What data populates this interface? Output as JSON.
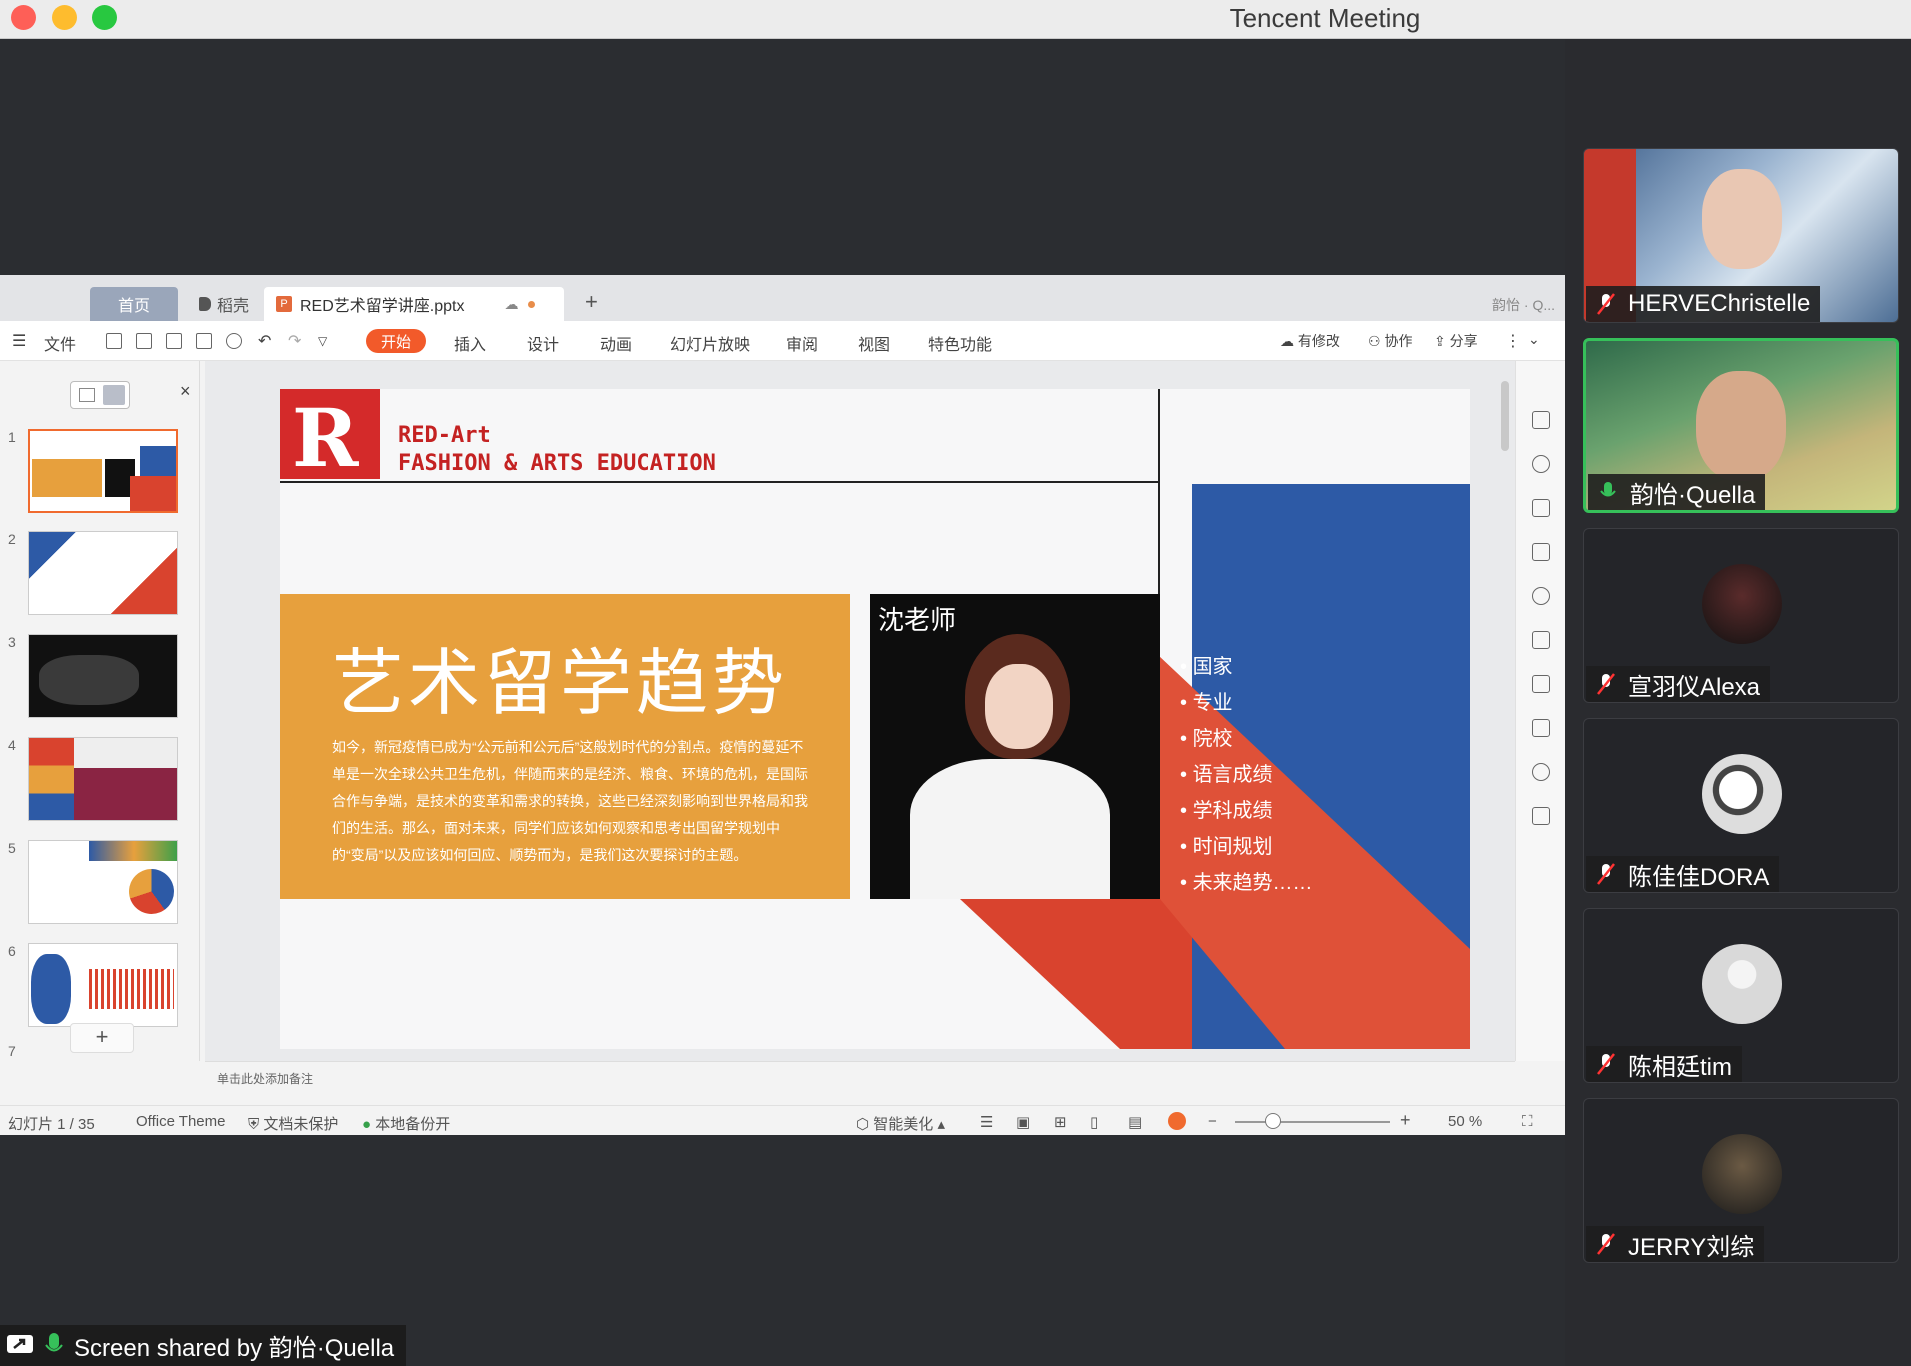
{
  "window": {
    "title": "Tencent Meeting"
  },
  "wps": {
    "tabs": {
      "home": "首页",
      "daoke": "稻壳",
      "file": "RED艺术留学讲座.pptx",
      "plus": "+",
      "user": "韵怡 · Q..."
    },
    "toolbar": {
      "file_menu": "文件",
      "start": "开始",
      "insert": "插入",
      "design": "设计",
      "animation": "动画",
      "slideshow": "幻灯片放映",
      "review": "审阅",
      "view": "视图",
      "special": "特色功能",
      "modified": "有修改",
      "collab": "协作",
      "share": "分享"
    },
    "thumbnails": [
      "1",
      "2",
      "3",
      "4",
      "5",
      "6",
      "7"
    ],
    "thumb_add": "+",
    "notes_placeholder": "单击此处添加备注",
    "slide": {
      "brand_line1": "RED-Art",
      "brand_line2": "FASHION & ARTS EDUCATION",
      "headline": "艺术留学趋势",
      "body": "如今，新冠疫情已成为“公元前和公元后”这般划时代的分割点。疫情的蔓延不单是一次全球公共卫生危机，伴随而来的是经济、粮食、环境的危机，是国际合作与争端，是技术的变革和需求的转换，这些已经深刻影响到世界格局和我们的生活。那么，面对未来，同学们应该如何观察和思考出国留学规划中的“变局”以及应该如何回应、顺势而为，是我们这次要探讨的主题。",
      "photo_label": "沈老师",
      "bullets": [
        "国家",
        "专业",
        "院校",
        "语言成绩",
        "学科成绩",
        "时间规划",
        "未来趋势……"
      ]
    },
    "status": {
      "slide_index": "幻灯片 1 / 35",
      "theme": "Office Theme",
      "protect": "文档未保护",
      "backup": "本地备份开",
      "beautify": "智能美化",
      "zoom": "50 %"
    }
  },
  "participants": [
    {
      "name": "HERVEChristelle",
      "muted": true
    },
    {
      "name": "韵怡·Quella",
      "muted": false
    },
    {
      "name": "宣羽仪Alexa",
      "muted": true
    },
    {
      "name": "陈佳佳DORA",
      "muted": true
    },
    {
      "name": "陈相廷tim",
      "muted": true
    },
    {
      "name": "JERRY刘综",
      "muted": true
    }
  ],
  "share_banner": "Screen shared by 韵怡·Quella",
  "colors": {
    "accent": "#f25a2a",
    "speaking": "#36c05a",
    "slide_orange": "#e7a03d",
    "slide_red": "#d9432e",
    "slide_blue": "#2d5aa6"
  }
}
